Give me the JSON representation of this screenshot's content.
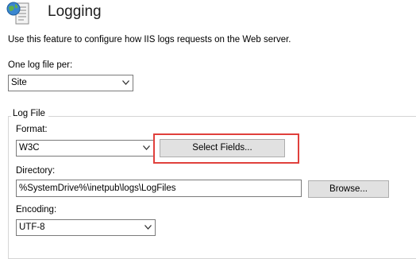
{
  "header": {
    "title": "Logging",
    "icon": "globe-log-icon"
  },
  "description": "Use this feature to configure how IIS logs requests on the Web server.",
  "log_file_per": {
    "label": "One log file per:",
    "value": "Site"
  },
  "log_file": {
    "group_label": "Log File",
    "format": {
      "label": "Format:",
      "value": "W3C",
      "select_fields_label": "Select Fields..."
    },
    "directory": {
      "label": "Directory:",
      "value": "%SystemDrive%\\inetpub\\logs\\LogFiles",
      "browse_label": "Browse..."
    },
    "encoding": {
      "label": "Encoding:",
      "value": "UTF-8"
    }
  },
  "colors": {
    "highlight": "#e0403c",
    "button_bg": "#e1e1e1"
  }
}
